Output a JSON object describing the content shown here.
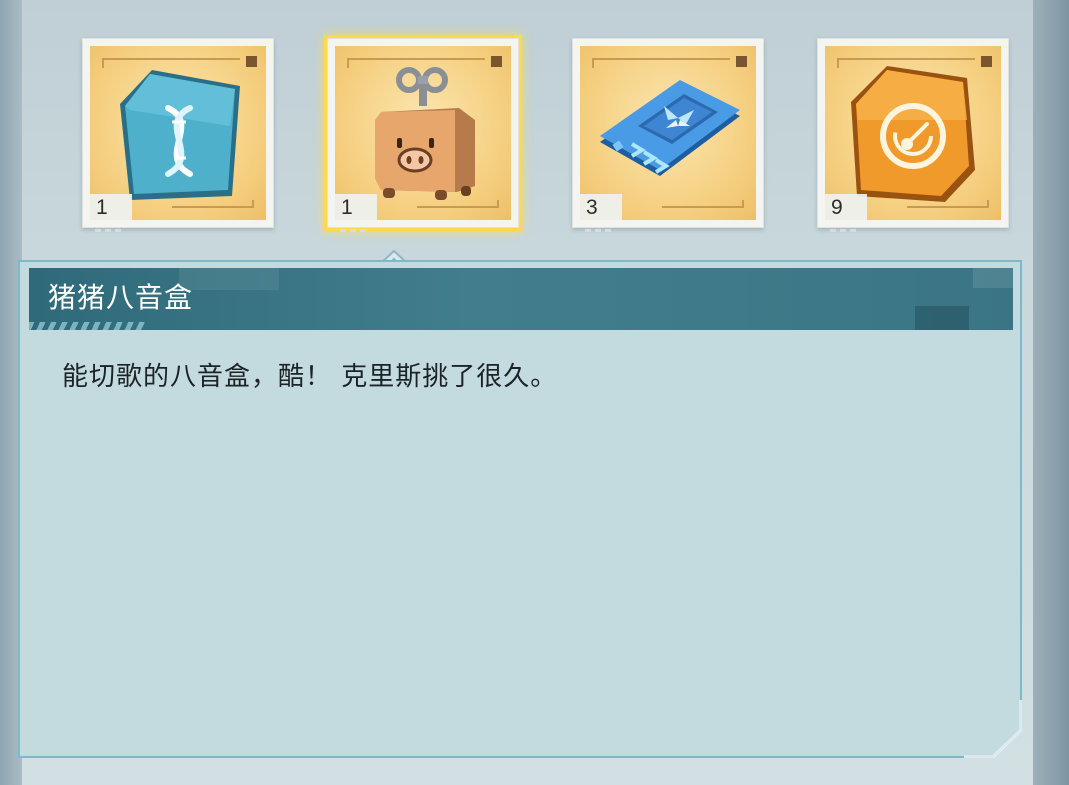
{
  "inventory": {
    "slots": [
      {
        "icon": "dna-card-icon",
        "count": "1",
        "selected": false
      },
      {
        "icon": "pig-music-box-icon",
        "count": "1",
        "selected": true
      },
      {
        "icon": "butterfly-chip-card-icon",
        "count": "3",
        "selected": false
      },
      {
        "icon": "speedometer-card-icon",
        "count": "9",
        "selected": false
      }
    ]
  },
  "detail": {
    "name": "猪猪八音盒",
    "description": "能切歌的八音盒，酷！ 克里斯挑了很久。"
  },
  "colors": {
    "selection_glow": "#ffd94a",
    "header": "#3b7585",
    "panel_fill": "#c3dbdf",
    "slot_background": "#f5cf80"
  }
}
